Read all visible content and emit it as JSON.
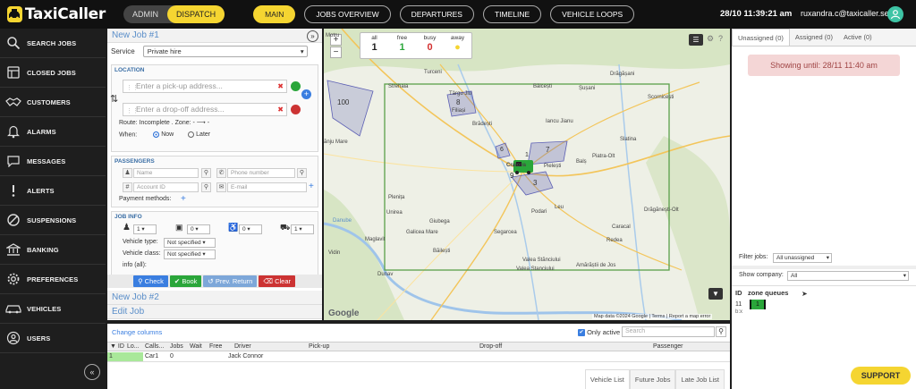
{
  "app": {
    "name": "TaxiCaller"
  },
  "header": {
    "mode_admin": "ADMIN",
    "mode_dispatch": "DISPATCH",
    "nav": [
      "MAIN",
      "JOBS OVERVIEW",
      "DEPARTURES",
      "TIMELINE",
      "VEHICLE LOOPS"
    ],
    "clock": "28/10 11:39:21 am",
    "user": "ruxandra.c@taxicaller.se"
  },
  "sidebar": {
    "items": [
      {
        "label": "SEARCH JOBS",
        "icon": "search-icon"
      },
      {
        "label": "CLOSED JOBS",
        "icon": "closed-jobs-icon"
      },
      {
        "label": "CUSTOMERS",
        "icon": "handshake-icon"
      },
      {
        "label": "ALARMS",
        "icon": "bell-icon"
      },
      {
        "label": "MESSAGES",
        "icon": "chat-icon"
      },
      {
        "label": "ALERTS",
        "icon": "alert-icon"
      },
      {
        "label": "SUSPENSIONS",
        "icon": "ban-icon"
      },
      {
        "label": "BANKING",
        "icon": "bank-icon"
      },
      {
        "label": "PREFERENCES",
        "icon": "gear-icon"
      },
      {
        "label": "VEHICLES",
        "icon": "car-icon"
      },
      {
        "label": "USERS",
        "icon": "user-icon"
      }
    ]
  },
  "jobform": {
    "title": "New Job #1",
    "service_label": "Service",
    "service_value": "Private hire",
    "location_heading": "LOCATION",
    "pickup_placeholder": "Enter a pick-up address...",
    "dropoff_placeholder": "Enter a drop-off address...",
    "route_text": "Route: Incomplete . Zone: - ⟶ -",
    "when_label": "When:",
    "when_now": "Now",
    "when_later": "Later",
    "passengers_heading": "PASSENGERS",
    "name_placeholder": "Name",
    "phone_placeholder": "Phone number",
    "account_placeholder": "Account ID",
    "email_placeholder": "E-mail",
    "payment_label": "Payment methods:",
    "jobinfo_heading": "JOB INFO",
    "count_passengers": "1",
    "count_luggage": "0",
    "count_wheelchair": "0",
    "count_vehicles": "1",
    "vehicle_type_label": "Vehicle type:",
    "vehicle_type_value": "Not specified",
    "vehicle_class_label": "Vehicle class:",
    "vehicle_class_value": "Not specified",
    "info_label": "info (all):",
    "buttons": {
      "check": "Check",
      "book": "Book",
      "prev_return": "Prev. Return",
      "clear": "Clear"
    },
    "job2": "New Job #2",
    "editjob": "Edit Job"
  },
  "map": {
    "status": {
      "all_label": "all",
      "all_value": "1",
      "free_label": "free",
      "free_value": "1",
      "busy_label": "busy",
      "busy_value": "0",
      "away_label": "away"
    },
    "labels": [
      {
        "text": "Motru"
      },
      {
        "text": "Strehaia"
      },
      {
        "text": "Târgu Jiu"
      },
      {
        "text": "Turceni"
      },
      {
        "text": "Bălcești"
      },
      {
        "text": "Șușani"
      },
      {
        "text": "Drăgășani"
      },
      {
        "text": "Scornicești"
      },
      {
        "text": "Filiași"
      },
      {
        "text": "Brădești"
      },
      {
        "text": "Iancu Jianu"
      },
      {
        "text": "Craiova"
      },
      {
        "text": "Pielești"
      },
      {
        "text": "Balș"
      },
      {
        "text": "Piatra-Olt"
      },
      {
        "text": "Slatina"
      },
      {
        "text": "Caracal"
      },
      {
        "text": "Drăgănești-Olt"
      },
      {
        "text": "Plenița"
      },
      {
        "text": "Unirea"
      },
      {
        "text": "Giubega"
      },
      {
        "text": "Podari"
      },
      {
        "text": "Leu"
      },
      {
        "text": "Galicea Mare"
      },
      {
        "text": "Segarcea"
      },
      {
        "text": "Redea"
      },
      {
        "text": "Băilești"
      },
      {
        "text": "Valea Stănciului"
      },
      {
        "text": "Amărăștii de Jos"
      },
      {
        "text": "Maglavit"
      },
      {
        "text": "Vidin"
      },
      {
        "text": "Dunav"
      },
      {
        "text": "Danube"
      },
      {
        "text": "ănju Mare"
      },
      {
        "text": "Valea Stanciului"
      }
    ],
    "zones": [
      {
        "id": "100"
      },
      {
        "id": "8"
      },
      {
        "id": "6"
      },
      {
        "id": "7"
      },
      {
        "id": "1"
      },
      {
        "id": "9"
      },
      {
        "id": "3"
      }
    ],
    "attribution": "Map data ©2024 Google  |  Terms  |  Report a map error",
    "google": "Google"
  },
  "rightpanel": {
    "tabs": [
      "Unassigned (0)",
      "Assigned (0)",
      "Active (0)"
    ],
    "showing_until": "Showing until: 28/11 11:40 am",
    "filter_label": "Filter jobs:",
    "filter_value": "All unassigned",
    "company_label": "Show company:",
    "company_value": "All",
    "id_header": "ID",
    "zone_header": "zone queues",
    "row_id": "11",
    "row_sub": "b:x",
    "row_queue": "1",
    "support": "SUPPORT"
  },
  "bottom": {
    "change_columns": "Change columns",
    "only_active": "Only active",
    "search_placeholder": "Search",
    "columns": [
      "▼ ID",
      "Lo...",
      "Calls...",
      "Jobs",
      "Wait",
      "Free",
      "Driver",
      "Pick-up",
      "Drop-off",
      "Passenger"
    ],
    "row": {
      "id": "1",
      "calls": "Car1",
      "jobs": "0",
      "driver": "Jack Connor"
    },
    "tabs": [
      "Vehicle List",
      "Future Jobs",
      "Late Job List"
    ]
  },
  "colors": {
    "accent": "#f5d531",
    "free": "#2aa63a",
    "busy": "#d33030",
    "away": "#f5d531",
    "zone_border": "#5c5fb4",
    "grid_rect": "#5aa04a"
  }
}
